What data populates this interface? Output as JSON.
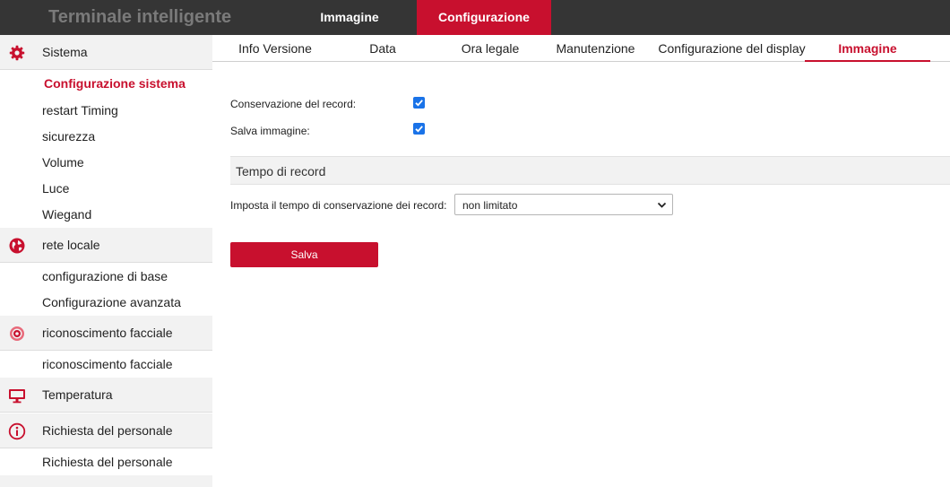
{
  "header": {
    "title": "Terminale intelligente",
    "tabs": [
      {
        "label": "Immagine"
      },
      {
        "label": "Configurazione"
      }
    ]
  },
  "sidebar": {
    "sections": [
      {
        "label": "Sistema",
        "icon": "gear-icon",
        "items": [
          "Configurazione sistema",
          "restart Timing",
          "sicurezza",
          "Volume",
          "Luce",
          "Wiegand"
        ]
      },
      {
        "label": "rete locale",
        "icon": "globe-icon",
        "items": [
          "configurazione di base",
          "Configurazione avanzata"
        ]
      },
      {
        "label": "riconoscimento facciale",
        "icon": "target-icon",
        "items": [
          "riconoscimento facciale"
        ]
      },
      {
        "label": "Temperatura",
        "icon": "monitor-icon",
        "items": []
      },
      {
        "label": "Richiesta del personale",
        "icon": "info-icon",
        "items": [
          "Richiesta del personale"
        ]
      }
    ]
  },
  "content": {
    "tabs": [
      "Info Versione",
      "Data",
      "Ora legale",
      "Manutenzione",
      "Configurazione del display",
      "Immagine"
    ],
    "record_retention_label": "Conservazione del record:",
    "record_retention_checked": true,
    "save_image_label": "Salva immagine:",
    "save_image_checked": true,
    "section_title": "Tempo di record",
    "retention_time_label": "Imposta il tempo di conservazione dei record:",
    "retention_time_value": "non limitato",
    "save_button": "Salva"
  },
  "colors": {
    "accent": "#c8102e",
    "topbar": "#353535",
    "checkbox": "#1a73e8"
  }
}
